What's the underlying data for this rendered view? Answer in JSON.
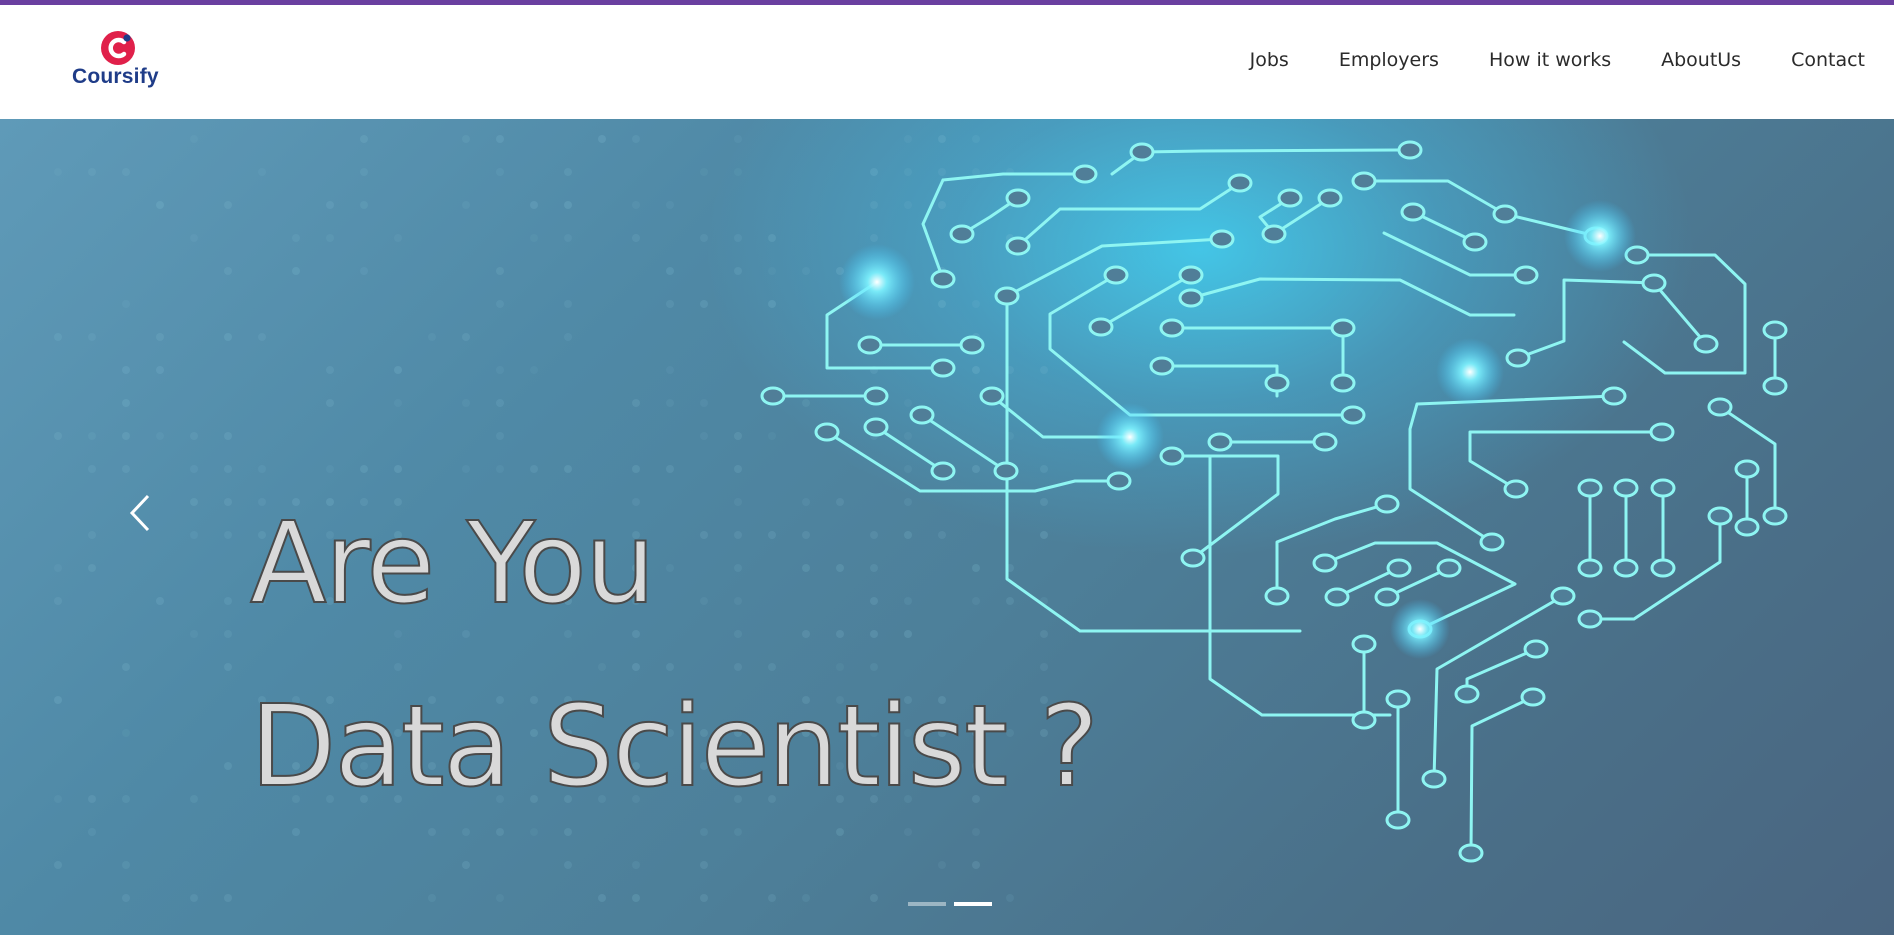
{
  "brand": {
    "name": "Coursify",
    "color": "#1f3c88",
    "mark_color": "#e0204a"
  },
  "nav": {
    "items": [
      {
        "label": "Jobs"
      },
      {
        "label": "Employers"
      },
      {
        "label": "How it works"
      },
      {
        "label": "AboutUs"
      },
      {
        "label": "Contact"
      }
    ]
  },
  "hero": {
    "headline_line1": "Are You",
    "headline_line2": "Data Scientist ?",
    "prev_icon": "chevron-left-icon",
    "slides_count": 2,
    "active_slide": 2,
    "accent_color": "#7ef3ff"
  },
  "colors": {
    "topline": "#6a3fa0",
    "navbar_bg": "#ffffff"
  }
}
